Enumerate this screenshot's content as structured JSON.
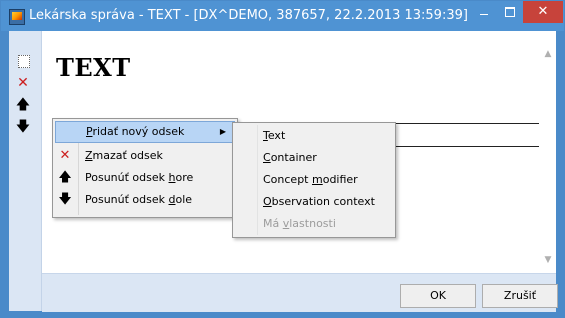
{
  "window": {
    "title": "Lekárska správa - TEXT - [DX^DEMO, 387657, 22.2.2013 13:59:39]",
    "minimize_glyph": "–",
    "close_glyph": "✕"
  },
  "toolbar": {
    "tools": [
      {
        "icon": "new-section-icon"
      },
      {
        "icon": "delete-icon",
        "glyph": "✕"
      },
      {
        "icon": "arrow-up-icon",
        "glyph": "🡅"
      },
      {
        "icon": "arrow-down-icon",
        "glyph": "🡇"
      }
    ]
  },
  "document": {
    "heading": "TEXT",
    "text_value": ""
  },
  "context_menu": {
    "items": [
      {
        "pre": "",
        "mnemonic": "P",
        "post": "ridať nový odsek",
        "icon": "",
        "has_submenu": true,
        "highlighted": true
      },
      {
        "pre": "",
        "mnemonic": "Z",
        "post": "mazať odsek",
        "icon": "✕"
      },
      {
        "pre": "Posunúť odsek ",
        "mnemonic": "h",
        "post": "ore",
        "icon": "🡅"
      },
      {
        "pre": "Posunúť odsek ",
        "mnemonic": "d",
        "post": "ole",
        "icon": "🡇"
      }
    ],
    "submenu_arrow": "▶"
  },
  "submenu": {
    "items": [
      {
        "pre": "",
        "mnemonic": "T",
        "post": "ext",
        "disabled": false
      },
      {
        "pre": "",
        "mnemonic": "C",
        "post": "ontainer",
        "disabled": false
      },
      {
        "pre": "Concept ",
        "mnemonic": "m",
        "post": "odifier",
        "disabled": false
      },
      {
        "pre": "",
        "mnemonic": "O",
        "post": "bservation context",
        "disabled": false
      },
      {
        "pre": "Má ",
        "mnemonic": "v",
        "post": "lastnosti",
        "disabled": true
      }
    ]
  },
  "buttons": {
    "ok": "OK",
    "cancel": "Zrušiť"
  },
  "colors": {
    "title_bar": "#4f93d3",
    "close_button": "#c7433b",
    "highlight": "#b8d5f5",
    "panel": "#dbe6f4"
  }
}
